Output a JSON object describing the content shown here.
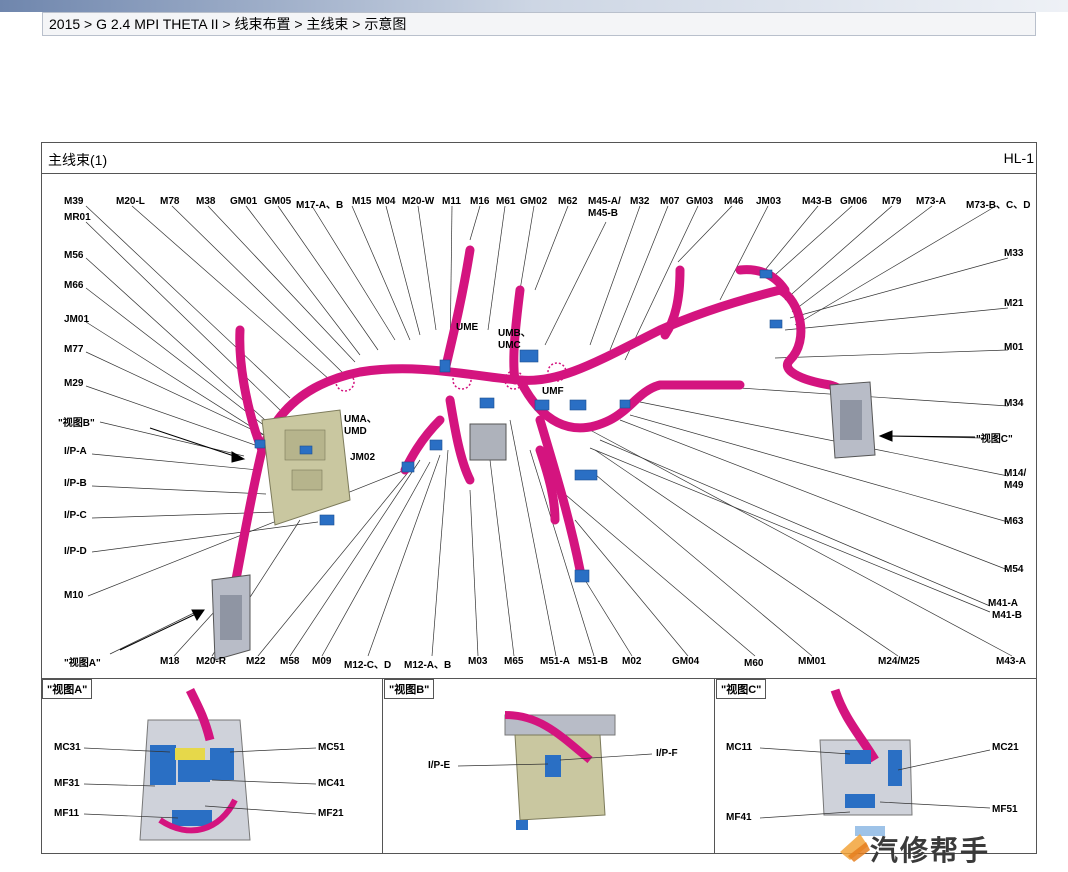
{
  "breadcrumb": "2015 > G 2.4 MPI THETA II > 线束布置 > 主线束 > 示意图",
  "panel": {
    "title": "主线束(1)",
    "code": "HL-1"
  },
  "labels": {
    "top": [
      "M20-L",
      "M78",
      "M38",
      "GM01",
      "GM05",
      "M17-A、B",
      "M15",
      "M04",
      "M20-W",
      "M11",
      "M16",
      "M61",
      "GM02",
      "M62",
      "M45-A/\nM45-B",
      "M32",
      "M07",
      "GM03",
      "M46",
      "JM03",
      "M43-B",
      "GM06",
      "M79",
      "M73-A",
      "M73-B、C、D"
    ],
    "left": [
      "M39",
      "MR01",
      "M56",
      "M66",
      "JM01",
      "M77",
      "M29",
      "\"视图B\"",
      "I/P-A",
      "I/P-B",
      "I/P-C",
      "I/P-D",
      "M10",
      "\"视图A\""
    ],
    "right": [
      "M33",
      "M21",
      "M01",
      "M34",
      "\"视图C\"",
      "M14/\nM49",
      "M63",
      "M54",
      "M41-A",
      "M41-B",
      "M43-A"
    ],
    "bottom": [
      "M18",
      "M20-R",
      "M22",
      "M58",
      "M09",
      "M12-C、D",
      "M12-A、B",
      "M03",
      "M65",
      "M51-A",
      "M51-B",
      "M02",
      "GM04",
      "M60",
      "MM01",
      "M24/M25"
    ],
    "inner": [
      "UME",
      "UMB、\nUMC",
      "UMF",
      "UMA、\nUMD",
      "JM02"
    ]
  },
  "views": {
    "a": {
      "title": "\"视图A\"",
      "labels": [
        "MC31",
        "MF31",
        "MF11",
        "MC51",
        "MC41",
        "MF21"
      ]
    },
    "b": {
      "title": "\"视图B\"",
      "labels": [
        "I/P-E",
        "I/P-F"
      ]
    },
    "c": {
      "title": "\"视图C\"",
      "labels": [
        "MC11",
        "MF41",
        "MC21",
        "MF51"
      ]
    }
  },
  "watermark": "汽修帮手",
  "colors": {
    "harness": "#d4147f",
    "connector": "#2a6fc4",
    "fusebox": "#c9c7a0",
    "bracket": "#b8bcc7"
  }
}
